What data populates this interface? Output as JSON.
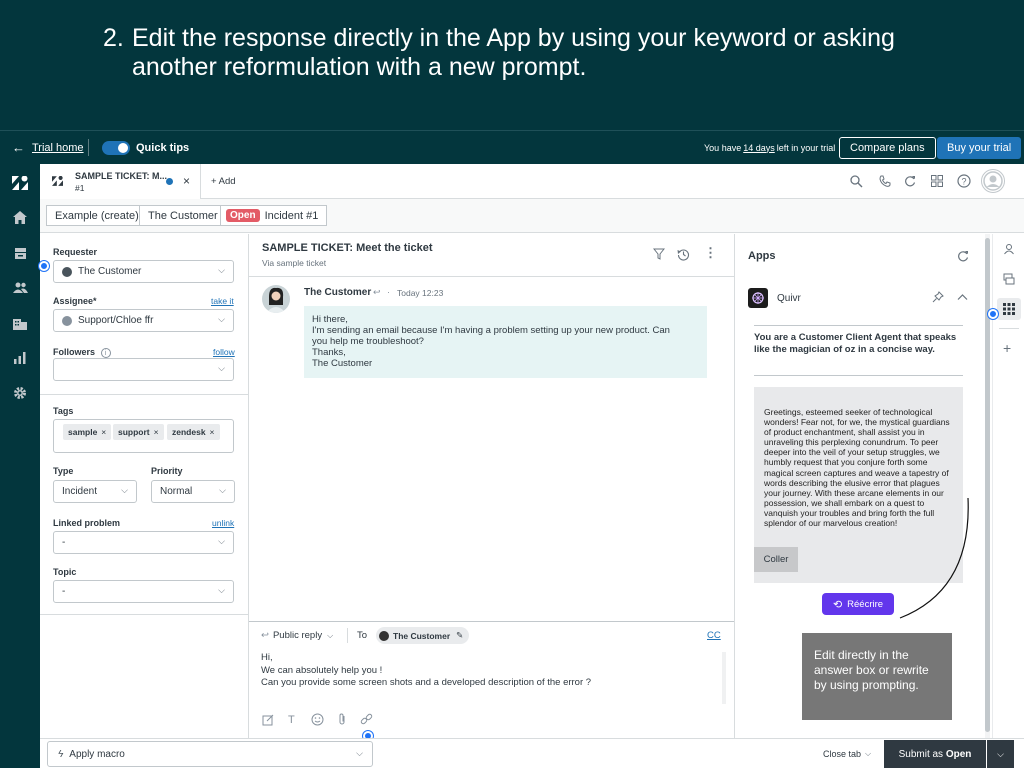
{
  "banner": {
    "number": "2.",
    "line1": "Edit the response directly in the App by using your keyword or asking",
    "line2": "another reformulation with a new prompt."
  },
  "topbar": {
    "trial_home": "Trial home",
    "quick_tips": "Quick tips",
    "trial_prefix": "You have ",
    "trial_days": "14 days",
    "trial_suffix": " left in your trial",
    "compare": "Compare plans",
    "buy": "Buy your trial"
  },
  "tab": {
    "title": "SAMPLE TICKET: M...",
    "subtitle": "#1",
    "add": "+ Add"
  },
  "breadcrumbs": {
    "org": "Example (create)",
    "user": "The Customer",
    "status": "Open",
    "incident": "Incident #1"
  },
  "props": {
    "requester_label": "Requester",
    "requester_value": "The Customer",
    "assignee_label": "Assignee*",
    "assignee_link": "take it",
    "assignee_value": "Support/Chloe ffr",
    "followers_label": "Followers",
    "followers_link": "follow",
    "tags_label": "Tags",
    "tags": [
      "sample",
      "support",
      "zendesk"
    ],
    "type_label": "Type",
    "type_value": "Incident",
    "priority_label": "Priority",
    "priority_value": "Normal",
    "linked_label": "Linked problem",
    "linked_link": "unlink",
    "linked_value": "-",
    "topic_label": "Topic",
    "topic_value": "-"
  },
  "ticket": {
    "title": "SAMPLE TICKET: Meet the ticket",
    "via": "Via sample ticket"
  },
  "message": {
    "author": "The Customer",
    "time": "Today 12:23",
    "lines": [
      "Hi there,",
      "I'm sending an email because I'm having a problem setting up your new product. Can",
      "you help me troubleshoot?",
      "Thanks,",
      "The Customer"
    ]
  },
  "reply": {
    "mode": "Public reply",
    "to": "To",
    "recipient": "The Customer",
    "cc": "CC",
    "lines": [
      "Hi,",
      "We can absolutely help you !",
      "Can you provide some screen shots and a developed description of the error ?"
    ]
  },
  "apps": {
    "title": "Apps",
    "app_name": "Quivr",
    "prompt": "You are a Customer Client Agent that speaks like the magician of oz in a concise way.",
    "response": "Greetings, esteemed seeker of technological wonders! Fear not, for we, the mystical guardians of product enchantment, shall assist you in unraveling this perplexing conundrum. To peer deeper into the veil of your setup struggles, we humbly request that you conjure forth some magical screen captures and weave a tapestry of words describing the elusive error that plagues your journey. With these arcane elements in our possession, we shall embark on a quest to vanquish your troubles and bring forth the full splendor of our marvelous creation!",
    "coller": "Coller",
    "rewrite": "Réécrire"
  },
  "tooltip": "Edit directly in the answer box or rewrite by using prompting.",
  "bottom": {
    "macro": "Apply macro",
    "close_tab": "Close tab",
    "submit_prefix": "Submit as ",
    "submit_status": "Open"
  },
  "colors": {
    "brand": "#03363d",
    "accent": "#1f73b7",
    "rewrite": "#6236ec",
    "open_badge": "#e35b66"
  }
}
